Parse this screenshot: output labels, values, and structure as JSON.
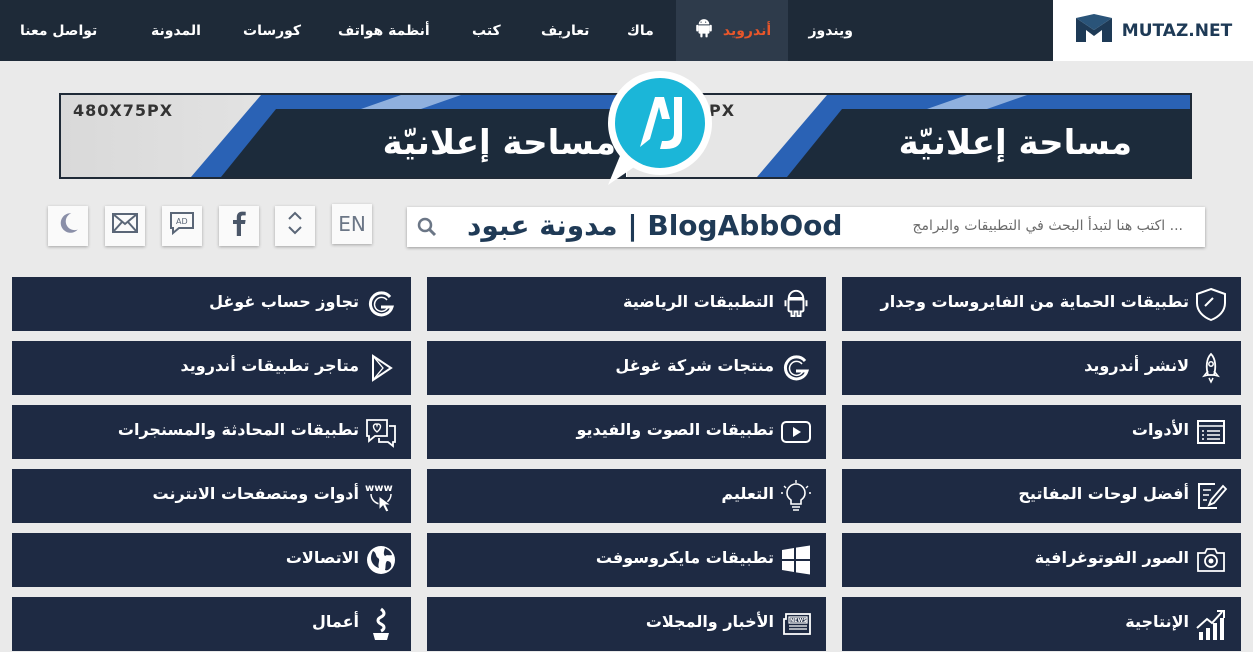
{
  "brand": {
    "logo_text": "MUTAZ.NET"
  },
  "nav": {
    "items": [
      {
        "label": "ويندوز"
      },
      {
        "label": "أندرويد",
        "active": true
      },
      {
        "label": "ماك"
      },
      {
        "label": "تعاريف"
      },
      {
        "label": "كتب"
      },
      {
        "label": "أنظمة هواتف"
      },
      {
        "label": "كورسات"
      },
      {
        "label": "المدونة"
      },
      {
        "label": "تواصل معنا"
      }
    ]
  },
  "ad": {
    "size_label": "480X75PX",
    "size_label_partial": "PX",
    "text": "مساحة إعلانيّة"
  },
  "search": {
    "placeholder": "اكتب هنا لتبدأ البحث في التطبيقات والبرامج ...",
    "brand": "مدونة عبود | BlogAbbOod"
  },
  "tools": {
    "language_label": "EN"
  },
  "categories": [
    {
      "label": "تطبيقات الحماية من الفايروسات وجدار",
      "icon": "shield-icon"
    },
    {
      "label": "التطبيقات الرياضية",
      "icon": "android-icon"
    },
    {
      "label": "تجاوز حساب غوغل",
      "icon": "google-icon"
    },
    {
      "label": "لانشر أندرويد",
      "icon": "rocket-icon"
    },
    {
      "label": "منتجات شركة غوغل",
      "icon": "google-icon"
    },
    {
      "label": "متاجر تطبيقات أندرويد",
      "icon": "play-store-icon"
    },
    {
      "label": "الأدوات",
      "icon": "list-window-icon"
    },
    {
      "label": "تطبيقات الصوت والفيديو",
      "icon": "video-play-icon"
    },
    {
      "label": "تطبيقات المحادثة والمسنجرات",
      "icon": "chat-heart-icon"
    },
    {
      "label": "أفضل لوحات المفاتيح",
      "icon": "edit-note-icon"
    },
    {
      "label": "التعليم",
      "icon": "lightbulb-icon"
    },
    {
      "label": "أدوات ومتصفحات الانترنت",
      "icon": "www-icon"
    },
    {
      "label": "الصور الفوتوغرافية",
      "icon": "camera-icon"
    },
    {
      "label": "تطبيقات مايكروسوفت",
      "icon": "windows-icon"
    },
    {
      "label": "الاتصالات",
      "icon": "globe-icon"
    },
    {
      "label": "الإنتاجية",
      "icon": "chart-growth-icon"
    },
    {
      "label": "الأخبار والمجلات",
      "icon": "newspaper-icon"
    },
    {
      "label": "أعمال",
      "icon": "business-icon"
    }
  ],
  "colors": {
    "topbar": "#1e2a38",
    "tile": "#1e2a43",
    "accent": "#e8562a",
    "ad_blue": "#2a62b5",
    "logo_cyan": "#1bb6d8"
  }
}
